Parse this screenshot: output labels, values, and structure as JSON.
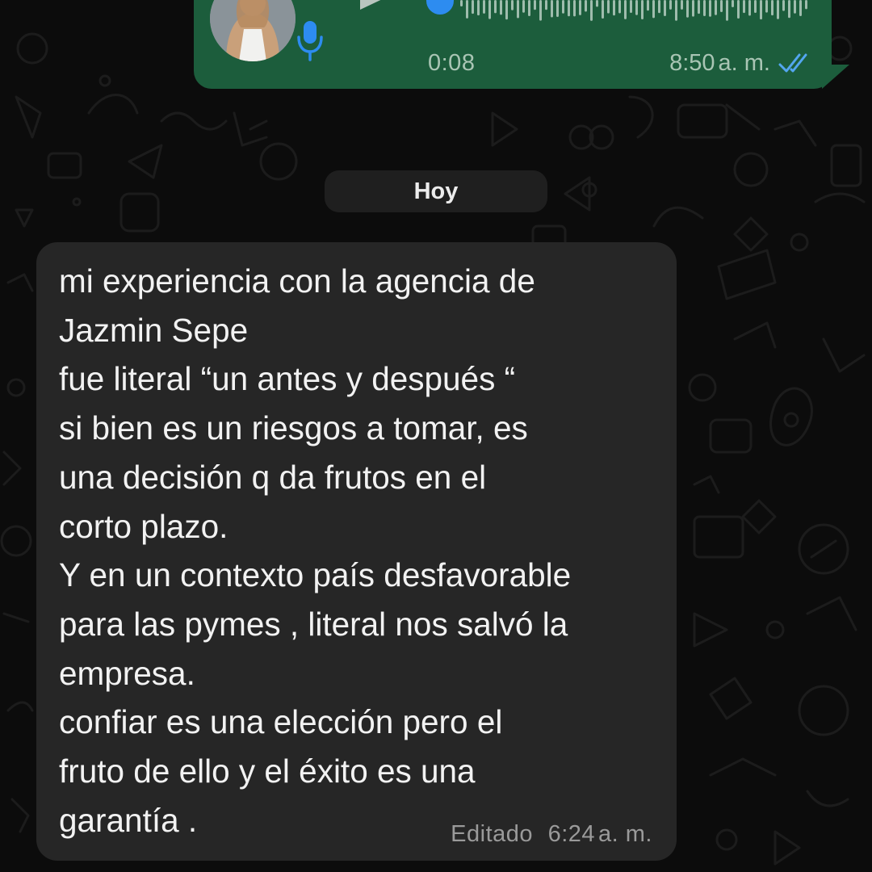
{
  "chat": {
    "voice_message": {
      "duration": "0:08",
      "time": "8:50",
      "time_suffix": "a. m.",
      "status_icon": "double-check-icon",
      "accent": "#1c5d3c"
    },
    "date_divider": "Hoy",
    "incoming_message": {
      "lines": [
        "mi experiencia con la agencia de",
        "Jazmin Sepe",
        "fue literal “un antes y después “",
        "si bien es un riesgos a tomar, es",
        "una decisión q da frutos en el",
        "corto plazo.",
        "Y en un contexto país desfavorable",
        "para las pymes , literal nos salvó la",
        "empresa.",
        "confiar es una elección pero el",
        "fruto de ello y el éxito es una",
        "garantía ."
      ],
      "edited_label": "Editado",
      "time": "6:24",
      "time_suffix": "a. m.",
      "bubble_color": "#262626"
    }
  }
}
